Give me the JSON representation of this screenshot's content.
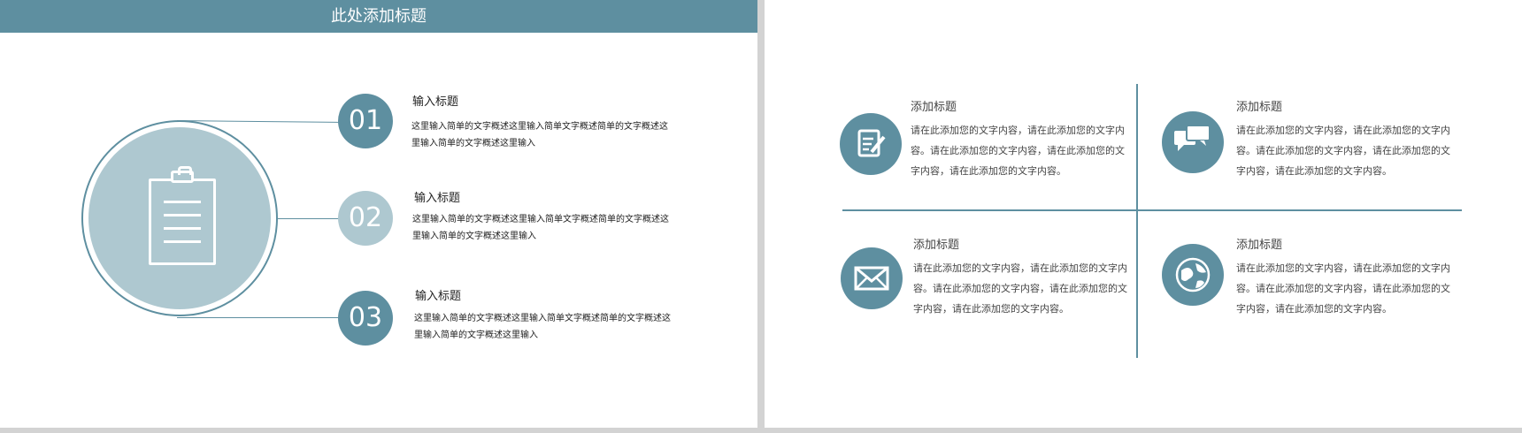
{
  "left_slide": {
    "title": "此处添加标题",
    "items": [
      {
        "number": "01",
        "title": "输入标题",
        "desc": "这里输入简单的文字概述这里输入简单文字概述简单的文字概述这里输入简单的文字概述这里输入"
      },
      {
        "number": "02",
        "title": "输入标题",
        "desc": "这里输入简单的文字概述这里输入简单文字概述简单的文字概述这里输入简单的文字概述这里输入"
      },
      {
        "number": "03",
        "title": "输入标题",
        "desc": "这里输入简单的文字概述这里输入简单文字概述简单的文字概述这里输入简单的文字概述这里输入"
      }
    ]
  },
  "right_slide": {
    "features": [
      {
        "icon": "edit-document-icon",
        "title": "添加标题",
        "desc": "请在此添加您的文字内容，请在此添加您的文字内容。请在此添加您的文字内容，请在此添加您的文字内容，请在此添加您的文字内容。"
      },
      {
        "icon": "chat-bubbles-icon",
        "title": "添加标题",
        "desc": "请在此添加您的文字内容，请在此添加您的文字内容。请在此添加您的文字内容，请在此添加您的文字内容，请在此添加您的文字内容。"
      },
      {
        "icon": "envelope-icon",
        "title": "添加标题",
        "desc": "请在此添加您的文字内容，请在此添加您的文字内容。请在此添加您的文字内容，请在此添加您的文字内容，请在此添加您的文字内容。"
      },
      {
        "icon": "globe-icon",
        "title": "添加标题",
        "desc": "请在此添加您的文字内容，请在此添加您的文字内容。请在此添加您的文字内容，请在此添加您的文字内容，请在此添加您的文字内容。"
      }
    ]
  },
  "colors": {
    "accent": "#5e8fa0",
    "accent_light": "#aec8d0",
    "background": "#ffffff"
  }
}
